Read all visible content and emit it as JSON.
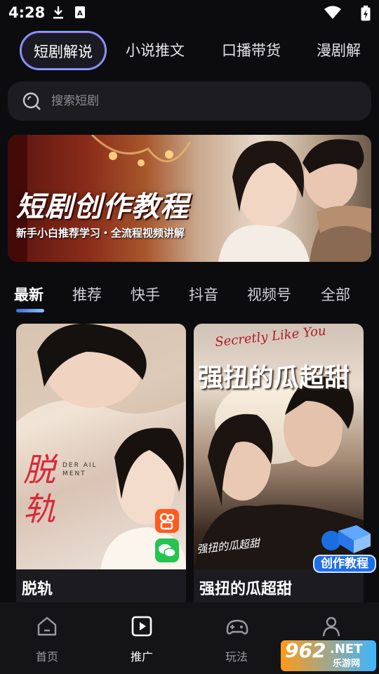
{
  "status_bar": {
    "time": "4:28",
    "icons": [
      "download-icon",
      "a-badge-icon",
      "wifi-icon",
      "battery-icon"
    ]
  },
  "category_tabs": [
    {
      "label": "短剧解说",
      "active": true
    },
    {
      "label": "小说推文",
      "active": false
    },
    {
      "label": "口播带货",
      "active": false
    },
    {
      "label": "漫剧解",
      "active": false
    }
  ],
  "search": {
    "placeholder": "搜索短剧",
    "icon": "search-icon"
  },
  "banner": {
    "title": "短剧创作教程",
    "subtitle": "新手小白推荐学习・全流程视频讲解"
  },
  "platform_tabs": [
    {
      "label": "最新",
      "active": true
    },
    {
      "label": "推荐",
      "active": false
    },
    {
      "label": "快手",
      "active": false
    },
    {
      "label": "抖音",
      "active": false
    },
    {
      "label": "视频号",
      "active": false
    },
    {
      "label": "全部",
      "active": false
    }
  ],
  "cards": [
    {
      "title": "脱轨",
      "poster_title": "脱轨",
      "poster_tag": "DER AIL MENT",
      "badges": [
        "kuaishou-icon",
        "wechat-icon"
      ]
    },
    {
      "title": "强扭的瓜超甜",
      "poster_title": "强扭的瓜超甜",
      "poster_script": "Secretly Like You",
      "poster_handwriting": "强扭的瓜超甜"
    }
  ],
  "create_tutorial_badge": "创作教程",
  "bottom_nav": [
    {
      "label": "首页",
      "icon": "home-icon",
      "active": false
    },
    {
      "label": "推广",
      "icon": "play-square-icon",
      "active": true
    },
    {
      "label": "玩法",
      "icon": "gamepad-icon",
      "active": false
    },
    {
      "label": "",
      "icon": "profile-icon",
      "active": false
    }
  ],
  "watermark": {
    "number": "962",
    "suffix": ".NET",
    "sub": "乐游网"
  },
  "colors": {
    "background": "#0c0c0f",
    "accent_blue": "#3a6fd8",
    "active_tab_border": "#7aa6ff"
  }
}
